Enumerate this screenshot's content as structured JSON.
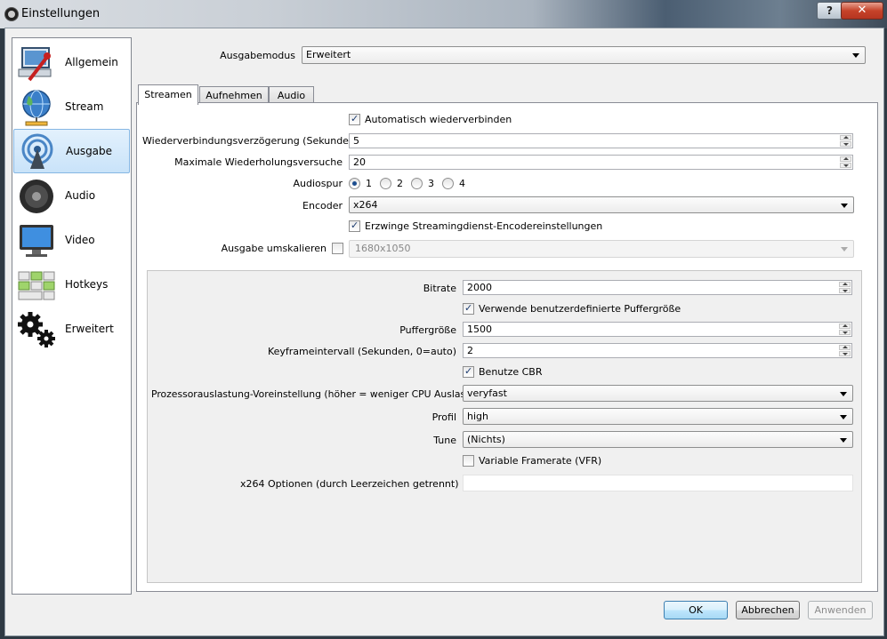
{
  "window": {
    "title": "Einstellungen",
    "help_label": "?",
    "close_label": "✕"
  },
  "sidebar": {
    "items": [
      {
        "label": "Allgemein",
        "icon": "computer-wrench-icon",
        "selected": false
      },
      {
        "label": "Stream",
        "icon": "globe-network-icon",
        "selected": false
      },
      {
        "label": "Ausgabe",
        "icon": "broadcast-antenna-icon",
        "selected": true
      },
      {
        "label": "Audio",
        "icon": "speaker-icon",
        "selected": false
      },
      {
        "label": "Video",
        "icon": "monitor-icon",
        "selected": false
      },
      {
        "label": "Hotkeys",
        "icon": "keyboard-icon",
        "selected": false
      },
      {
        "label": "Erweitert",
        "icon": "gears-icon",
        "selected": false
      }
    ]
  },
  "output_mode": {
    "label": "Ausgabemodus",
    "value": "Erweitert"
  },
  "tabs": [
    {
      "label": "Streamen",
      "active": true
    },
    {
      "label": "Aufnehmen",
      "active": false
    },
    {
      "label": "Audio",
      "active": false
    }
  ],
  "streaming": {
    "auto_reconnect": {
      "label": "Automatisch wiederverbinden",
      "checked": true
    },
    "reconnect_delay": {
      "label": "Wiederverbindungsverzögerung (Sekunden)",
      "value": "5"
    },
    "max_retries": {
      "label": "Maximale Wiederholungsversuche",
      "value": "20"
    },
    "audio_track": {
      "label": "Audiospur",
      "options": [
        "1",
        "2",
        "3",
        "4"
      ],
      "selected": "1"
    },
    "encoder": {
      "label": "Encoder",
      "value": "x264"
    },
    "enforce_encoder": {
      "label": "Erzwinge Streamingdienst-Encodereinstellungen",
      "checked": true
    },
    "rescale": {
      "label": "Ausgabe umskalieren",
      "checked": false,
      "value": "1680x1050"
    }
  },
  "encoder_settings": {
    "bitrate": {
      "label": "Bitrate",
      "value": "2000"
    },
    "custom_buffer": {
      "label": "Verwende benutzerdefinierte Puffergröße",
      "checked": true
    },
    "buffer_size": {
      "label": "Puffergröße",
      "value": "1500"
    },
    "keyframe_interval": {
      "label": "Keyframeintervall (Sekunden, 0=auto)",
      "value": "2"
    },
    "use_cbr": {
      "label": "Benutze CBR",
      "checked": true
    },
    "cpu_preset": {
      "label": "Prozessorauslastung-Voreinstellung (höher = weniger CPU Auslastung)",
      "value": "veryfast"
    },
    "profile": {
      "label": "Profil",
      "value": "high"
    },
    "tune": {
      "label": "Tune",
      "value": "(Nichts)"
    },
    "vfr": {
      "label": "Variable Framerate (VFR)",
      "checked": false
    },
    "x264_options": {
      "label": "x264 Optionen (durch Leerzeichen getrennt)",
      "value": ""
    }
  },
  "buttons": {
    "ok": "OK",
    "cancel": "Abbrechen",
    "apply": "Anwenden"
  }
}
